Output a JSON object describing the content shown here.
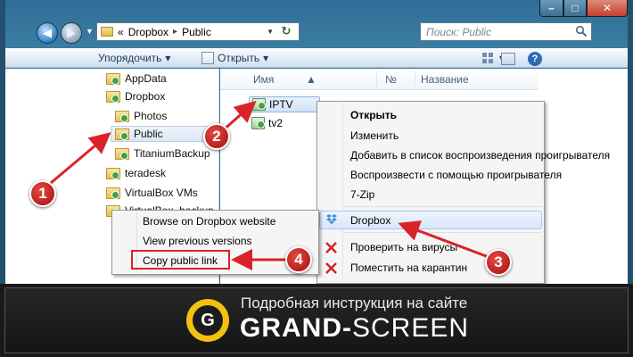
{
  "window": {
    "address": {
      "prefix": "«",
      "parts": [
        "Dropbox",
        "Public"
      ],
      "separator": "▸"
    },
    "search_placeholder": "Поиск: Public",
    "caption": {
      "minimize": "–",
      "maximize": "□",
      "close": "✕"
    }
  },
  "toolbar": {
    "organize": "Упорядочить",
    "open": "Открыть",
    "dropdown_glyph": "▾",
    "help": "?"
  },
  "navpane": {
    "items": [
      {
        "label": "AppData"
      },
      {
        "label": "Dropbox"
      },
      {
        "label": "Photos"
      },
      {
        "label": "Public"
      },
      {
        "label": "TitaniumBackup"
      },
      {
        "label": "teradesk"
      },
      {
        "label": "VirtualBox VMs"
      },
      {
        "label": "VirtualBox_backup"
      }
    ]
  },
  "content": {
    "columns": [
      "Имя",
      "№",
      "Название"
    ],
    "files": [
      {
        "name": "IPTV"
      },
      {
        "name": "tv2"
      }
    ]
  },
  "context_menu": {
    "items": [
      {
        "label": "Открыть",
        "bold": true
      },
      {
        "label": "Изменить"
      },
      {
        "label": "Добавить в список воспроизведения проигрывателя"
      },
      {
        "label": "Воспроизвести с помощью проигрывателя"
      },
      {
        "label": "7-Zip"
      },
      {
        "label": "Dropbox"
      },
      {
        "label": "Проверить на вирусы"
      },
      {
        "label": "Поместить на карантин"
      }
    ]
  },
  "dropbox_submenu": {
    "items": [
      {
        "label": "Browse on Dropbox website"
      },
      {
        "label": "View previous versions"
      },
      {
        "label": "Copy public link"
      }
    ]
  },
  "annotations": {
    "badges": [
      "1",
      "2",
      "3",
      "4"
    ],
    "arrow_color": "#d9232a"
  },
  "banner": {
    "subtitle": "Подробная инструкция на сайте",
    "brand_bold": "GRAND-",
    "brand_thin": "SCREEN",
    "logo_letter": "G",
    "logo_color": "#f3c10f"
  }
}
